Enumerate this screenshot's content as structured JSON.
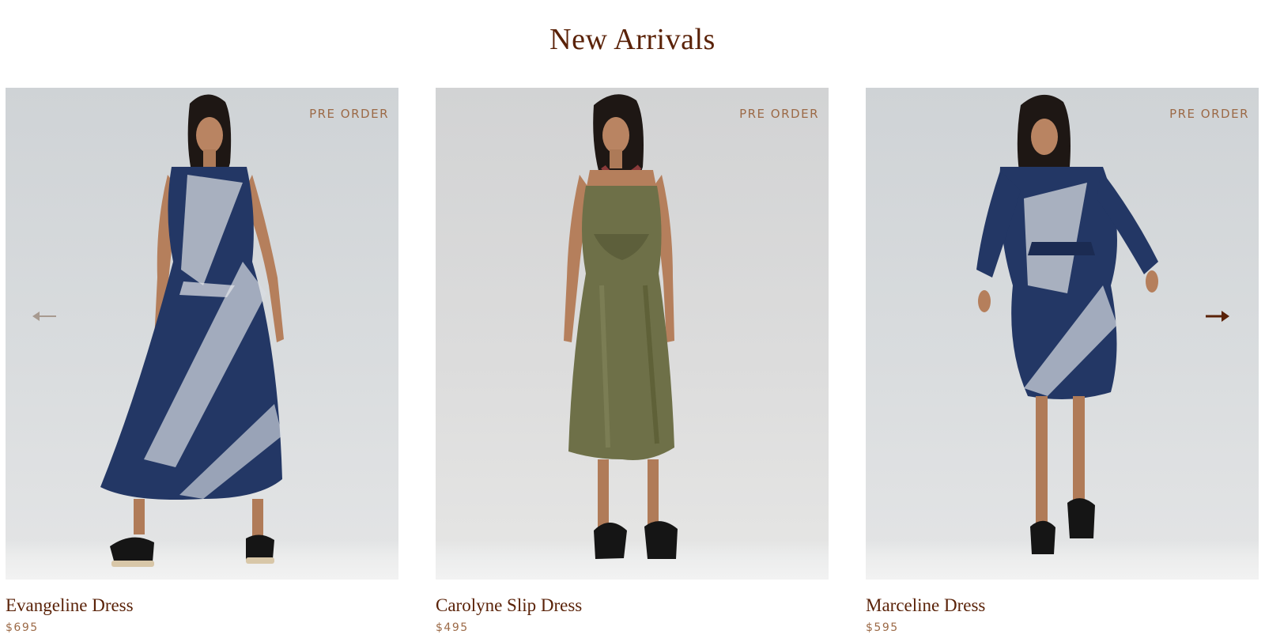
{
  "section": {
    "title": "New Arrivals"
  },
  "carousel": {
    "prev_icon": "arrow-left-icon",
    "next_icon": "arrow-right-icon",
    "prev_color": "#a79a90",
    "next_color": "#5a2208"
  },
  "colors": {
    "accent": "#5a2208",
    "muted": "#9c6a47"
  },
  "products": [
    {
      "name": "Evangeline Dress",
      "price": "$695",
      "badge": "PRE ORDER"
    },
    {
      "name": "Carolyne Slip Dress",
      "price": "$495",
      "badge": "PRE ORDER"
    },
    {
      "name": "Marceline Dress",
      "price": "$595",
      "badge": "PRE ORDER"
    }
  ]
}
